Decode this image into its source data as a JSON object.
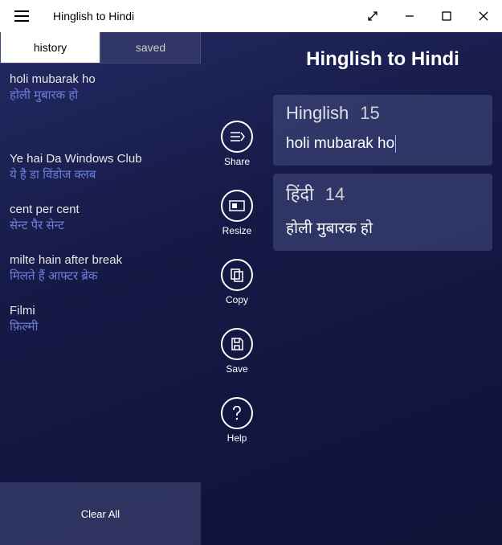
{
  "titlebar": {
    "title": "Hinglish to Hindi"
  },
  "sidebar": {
    "tabs": {
      "history": "history",
      "saved": "saved"
    },
    "history": [
      {
        "en": "holi mubarak ho",
        "hi": "होली मुबारक हो"
      },
      {
        "en": "Ye hai Da Windows Club",
        "hi": "ये है डा विंडोज क्लब"
      },
      {
        "en": "cent per cent",
        "hi": "सेन्ट पैर सेन्ट"
      },
      {
        "en": "milte hain after break",
        "hi": "मिलते हैं आफ्टर ब्रेक"
      },
      {
        "en": "Filmi",
        "hi": "फ़िल्मी"
      }
    ],
    "clear": "Clear All"
  },
  "actions": {
    "share": "Share",
    "resize": "Resize",
    "copy": "Copy",
    "save": "Save",
    "help": "Help"
  },
  "main": {
    "app_title": "Hinglish to Hindi",
    "input": {
      "label": "Hinglish",
      "count": "15",
      "value": "holi mubarak ho"
    },
    "output": {
      "label": "हिंदी",
      "count": "14",
      "value": "होली मुबारक हो"
    }
  }
}
